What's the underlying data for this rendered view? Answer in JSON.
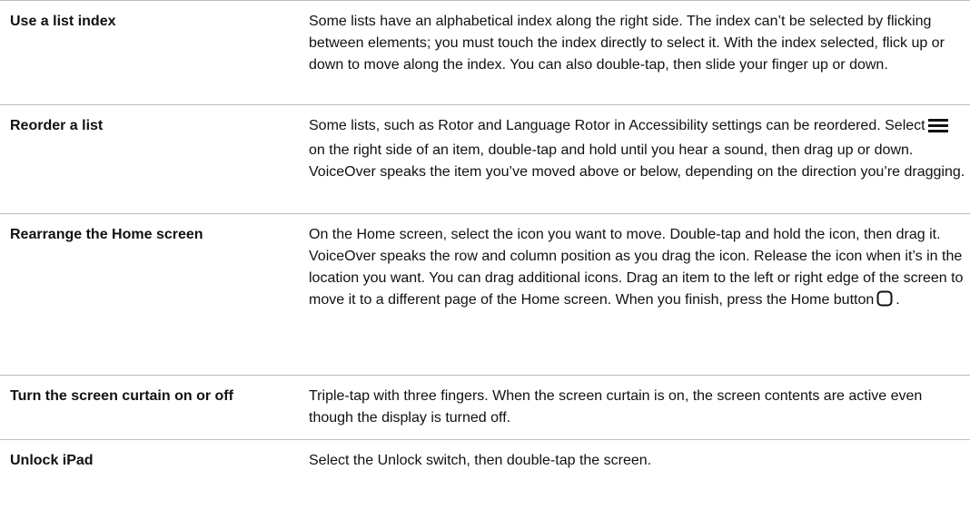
{
  "rows": [
    {
      "action": "Use a list index",
      "description": "Some lists have an alphabetical index along the right side. The index can’t be selected by flicking between elements; you must touch the index directly to select it. With the index selected, flick up or down to move along the index. You can also double-tap, then slide your finger up or down."
    },
    {
      "action": "Reorder a list",
      "description_before_icon": "Some lists, such as Rotor and Language Rotor in Accessibility settings can be reordered. Select",
      "inline_icon": "reorder-handle-icon",
      "description_after_icon": "on the right side of an item, double-tap and hold until you hear a sound, then drag up or down. VoiceOver speaks the item you’ve moved above or below, depending on the direction you’re dragging."
    },
    {
      "action": "Rearrange the Home screen",
      "description_before_icon": "On the Home screen, select the icon you want to move. Double-tap and hold the icon, then drag it. VoiceOver speaks the row and column position as you drag the icon. Release the icon when it’s in the location you want. You can drag additional icons. Drag an item to the left or right edge of the screen to move it to a different page of the Home screen. When you finish, press the Home button",
      "inline_icon": "home-button-icon",
      "description_after_icon": "."
    },
    {
      "action": "Turn the screen curtain on or off",
      "description": "Triple-tap with three fingers. When the screen curtain is on, the screen contents are active even though the display is turned off."
    },
    {
      "action": "Unlock iPad",
      "description": "Select the Unlock switch, then double-tap the screen."
    }
  ]
}
